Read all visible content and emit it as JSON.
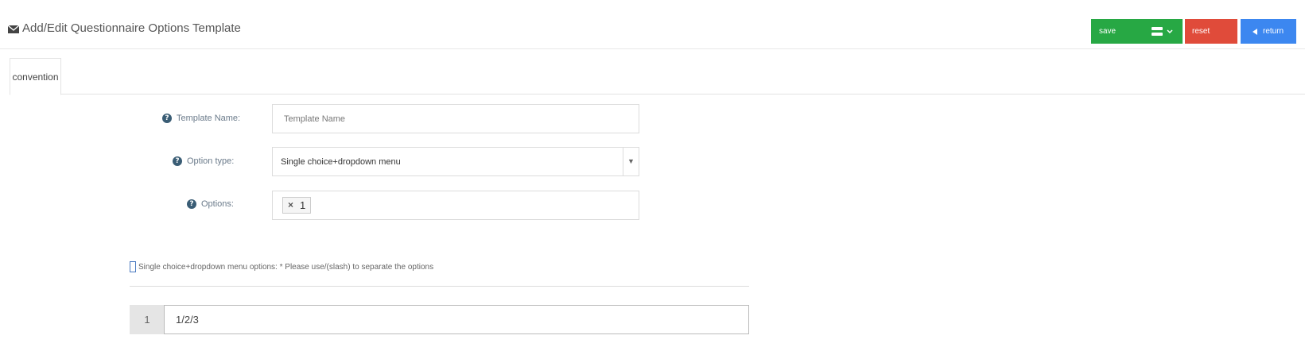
{
  "header": {
    "title": "Add/Edit Questionnaire Options Template",
    "title_icon": "envelope-icon"
  },
  "toolbar": {
    "save_label": "save",
    "reset_label": "reset",
    "return_label": "return",
    "colors": {
      "save": "#27a844",
      "reset": "#e04b3a",
      "return": "#3c87f0"
    }
  },
  "tabs": [
    {
      "label": "convention",
      "active": true
    }
  ],
  "form": {
    "template_name": {
      "label": "Template Name:",
      "placeholder": "Template Name",
      "value": ""
    },
    "option_type": {
      "label": "Option type:",
      "value": "Single choice+dropdown menu"
    },
    "options": {
      "label": "Options:",
      "tags": [
        "1"
      ]
    }
  },
  "options_section": {
    "note": "Single choice+dropdown menu options: * Please use/(slash) to separate the options",
    "rows": [
      {
        "index": "1",
        "value": "1/2/3"
      }
    ]
  }
}
